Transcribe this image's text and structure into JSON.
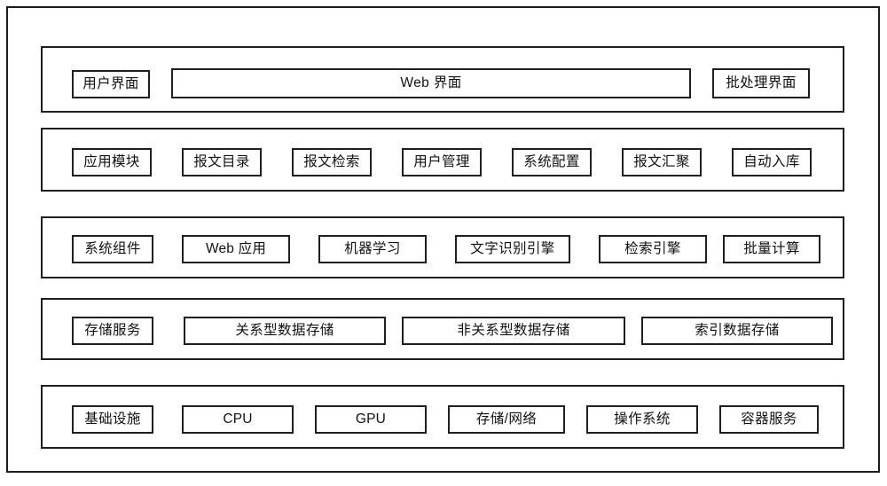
{
  "diagram": {
    "type": "layered-architecture",
    "title": "",
    "layers": [
      {
        "id": "user-interface",
        "label": "用户界面",
        "nodes": [
          {
            "id": "web-interface",
            "label": "Web 界面"
          },
          {
            "id": "batch-interface",
            "label": "批处理界面"
          }
        ]
      },
      {
        "id": "application-module",
        "label": "应用模块",
        "nodes": [
          {
            "id": "message-catalog",
            "label": "报文目录"
          },
          {
            "id": "message-search",
            "label": "报文检索"
          },
          {
            "id": "user-management",
            "label": "用户管理"
          },
          {
            "id": "system-configuration",
            "label": "系统配置"
          },
          {
            "id": "message-aggregation",
            "label": "报文汇聚"
          },
          {
            "id": "auto-ingest",
            "label": "自动入库"
          }
        ]
      },
      {
        "id": "system-component",
        "label": "系统组件",
        "nodes": [
          {
            "id": "web-application",
            "label": "Web 应用"
          },
          {
            "id": "machine-learning",
            "label": "机器学习"
          },
          {
            "id": "ocr-engine",
            "label": "文字识别引擎"
          },
          {
            "id": "search-engine",
            "label": "检索引擎"
          },
          {
            "id": "batch-computing",
            "label": "批量计算"
          }
        ]
      },
      {
        "id": "storage-service",
        "label": "存储服务",
        "nodes": [
          {
            "id": "relational-storage",
            "label": "关系型数据存储"
          },
          {
            "id": "non-relational-storage",
            "label": "非关系型数据存储"
          },
          {
            "id": "index-storage",
            "label": "索引数据存储"
          }
        ]
      },
      {
        "id": "infrastructure",
        "label": "基础设施",
        "nodes": [
          {
            "id": "cpu",
            "label": "CPU"
          },
          {
            "id": "gpu",
            "label": "GPU"
          },
          {
            "id": "storage-network",
            "label": "存储/网络"
          },
          {
            "id": "operating-system",
            "label": "操作系统"
          },
          {
            "id": "container-service",
            "label": "容器服务"
          }
        ]
      }
    ],
    "colors": {
      "background": "#ffffff",
      "border": "#1f1f1f",
      "outer_border": "#1c1c1c",
      "text": "#111111"
    }
  }
}
